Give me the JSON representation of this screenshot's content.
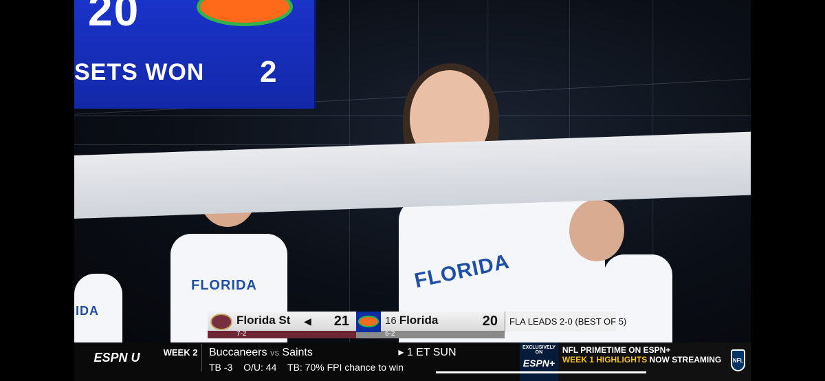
{
  "scoreboard_display": {
    "score": "20",
    "sets_label": "SETS WON",
    "sets_value": "2"
  },
  "jerseys": {
    "left_player": "FLORIDA",
    "center_player": "FLORIDA",
    "left_edge_player": "IDA"
  },
  "scorebug": {
    "team1": {
      "name": "Florida St",
      "record": "7-2",
      "points": "21",
      "serve_indicator": "◀"
    },
    "team2": {
      "rank": "16",
      "name": "Florida",
      "record": "6-2",
      "points": "20"
    },
    "status": "FLA LEADS 2-0 (BEST OF 5)"
  },
  "ticker": {
    "network": "ESPN U",
    "week": "WEEK 2",
    "away_team": "Buccaneers",
    "vs": "vs",
    "home_team": "Saints",
    "time": "1 ET SUN",
    "spread": "TB -3",
    "over_under": "O/U: 44",
    "fpi": "TB: 70% FPI chance to win",
    "promo": {
      "exclusive_label": "EXCLUSIVELY ON",
      "exclusive_brand": "ESPN+",
      "line1": "NFL PRIMETIME ON ESPN+",
      "line2": "WEEK 1 HIGHLIGHTS",
      "line2b": "NOW STREAMING",
      "nfl_logo": "NFL"
    }
  }
}
